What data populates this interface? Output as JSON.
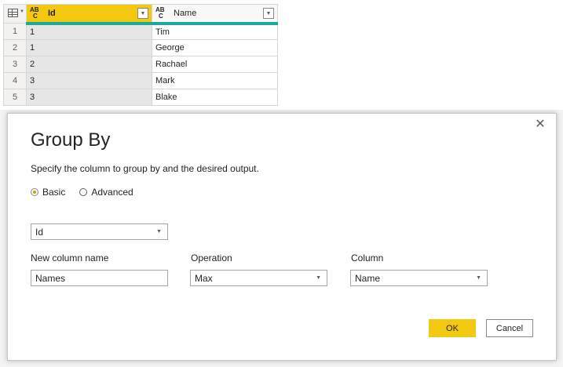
{
  "grid": {
    "columns": [
      {
        "type_top": "A",
        "type_mid": "B",
        "type_sub": "C",
        "label": "Id"
      },
      {
        "type_top": "A",
        "type_mid": "B",
        "type_sub": "C",
        "label": "Name"
      }
    ],
    "rows": [
      {
        "num": "1",
        "id": "1",
        "name": "Tim"
      },
      {
        "num": "2",
        "id": "1",
        "name": "George"
      },
      {
        "num": "3",
        "id": "2",
        "name": "Rachael"
      },
      {
        "num": "4",
        "id": "3",
        "name": "Mark"
      },
      {
        "num": "5",
        "id": "3",
        "name": "Blake"
      }
    ]
  },
  "dialog": {
    "title": "Group By",
    "description": "Specify the column to group by and the desired output.",
    "close_glyph": "✕",
    "mode_basic": "Basic",
    "mode_advanced": "Advanced",
    "group_by_value": "Id",
    "new_column_label": "New column name",
    "new_column_value": "Names",
    "operation_label": "Operation",
    "operation_value": "Max",
    "column_label": "Column",
    "column_value": "Name",
    "ok_label": "OK",
    "cancel_label": "Cancel"
  },
  "colors": {
    "accent": "#f2c811",
    "header_underline": "#1ba99b"
  },
  "icons": {
    "table_menu": "table-icon",
    "column_dropdown": "chevron-down-icon",
    "close": "close-icon"
  }
}
